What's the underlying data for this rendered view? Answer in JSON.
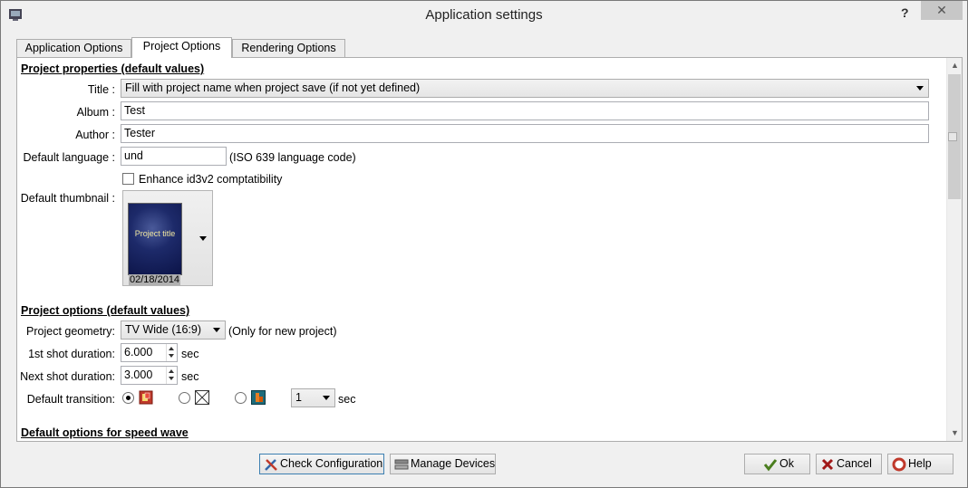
{
  "window": {
    "title": "Application settings",
    "help_glyph": "?",
    "close_glyph": "✕"
  },
  "tabs": [
    {
      "label": "Application Options"
    },
    {
      "label": "Project Options"
    },
    {
      "label": "Rendering Options"
    }
  ],
  "project_properties": {
    "section_title": "Project properties (default values)",
    "title_label": "Title :",
    "title_value": "Fill with project name when project save (if not yet defined)",
    "album_label": "Album :",
    "album_value": "Test",
    "author_label": "Author :",
    "author_value": "Tester",
    "language_label": "Default language :",
    "language_value": "und",
    "language_note": "(ISO 639 language code)",
    "id3_label": "Enhance id3v2 comptatibility",
    "id3_checked": false,
    "thumbnail_label": "Default thumbnail :",
    "thumbnail_title": "Project title",
    "thumbnail_date": "02/18/2014"
  },
  "project_options": {
    "section_title": "Project options (default values)",
    "geometry_label": "Project geometry:",
    "geometry_value": "TV Wide (16:9)",
    "geometry_note": "(Only for new project)",
    "first_shot_label": "1st shot duration:",
    "first_shot_value": "6.000",
    "next_shot_label": "Next shot duration:",
    "next_shot_value": "3.000",
    "sec_unit": "sec",
    "transition_label": "Default transition:",
    "transition_selected": 0,
    "transition_icons": [
      "random-transition-icon",
      "no-transition-icon",
      "basic-transition-icon"
    ],
    "transition_duration": "1"
  },
  "speed_wave": {
    "section_title": "Default options for speed wave"
  },
  "buttons": {
    "check_config": "Check Configuration",
    "manage_devices": "Manage Devices",
    "ok": "Ok",
    "cancel": "Cancel",
    "help": "Help"
  },
  "colors": {
    "accent_focus": "#3c7fb1",
    "window_bg": "#f0f0f0"
  }
}
